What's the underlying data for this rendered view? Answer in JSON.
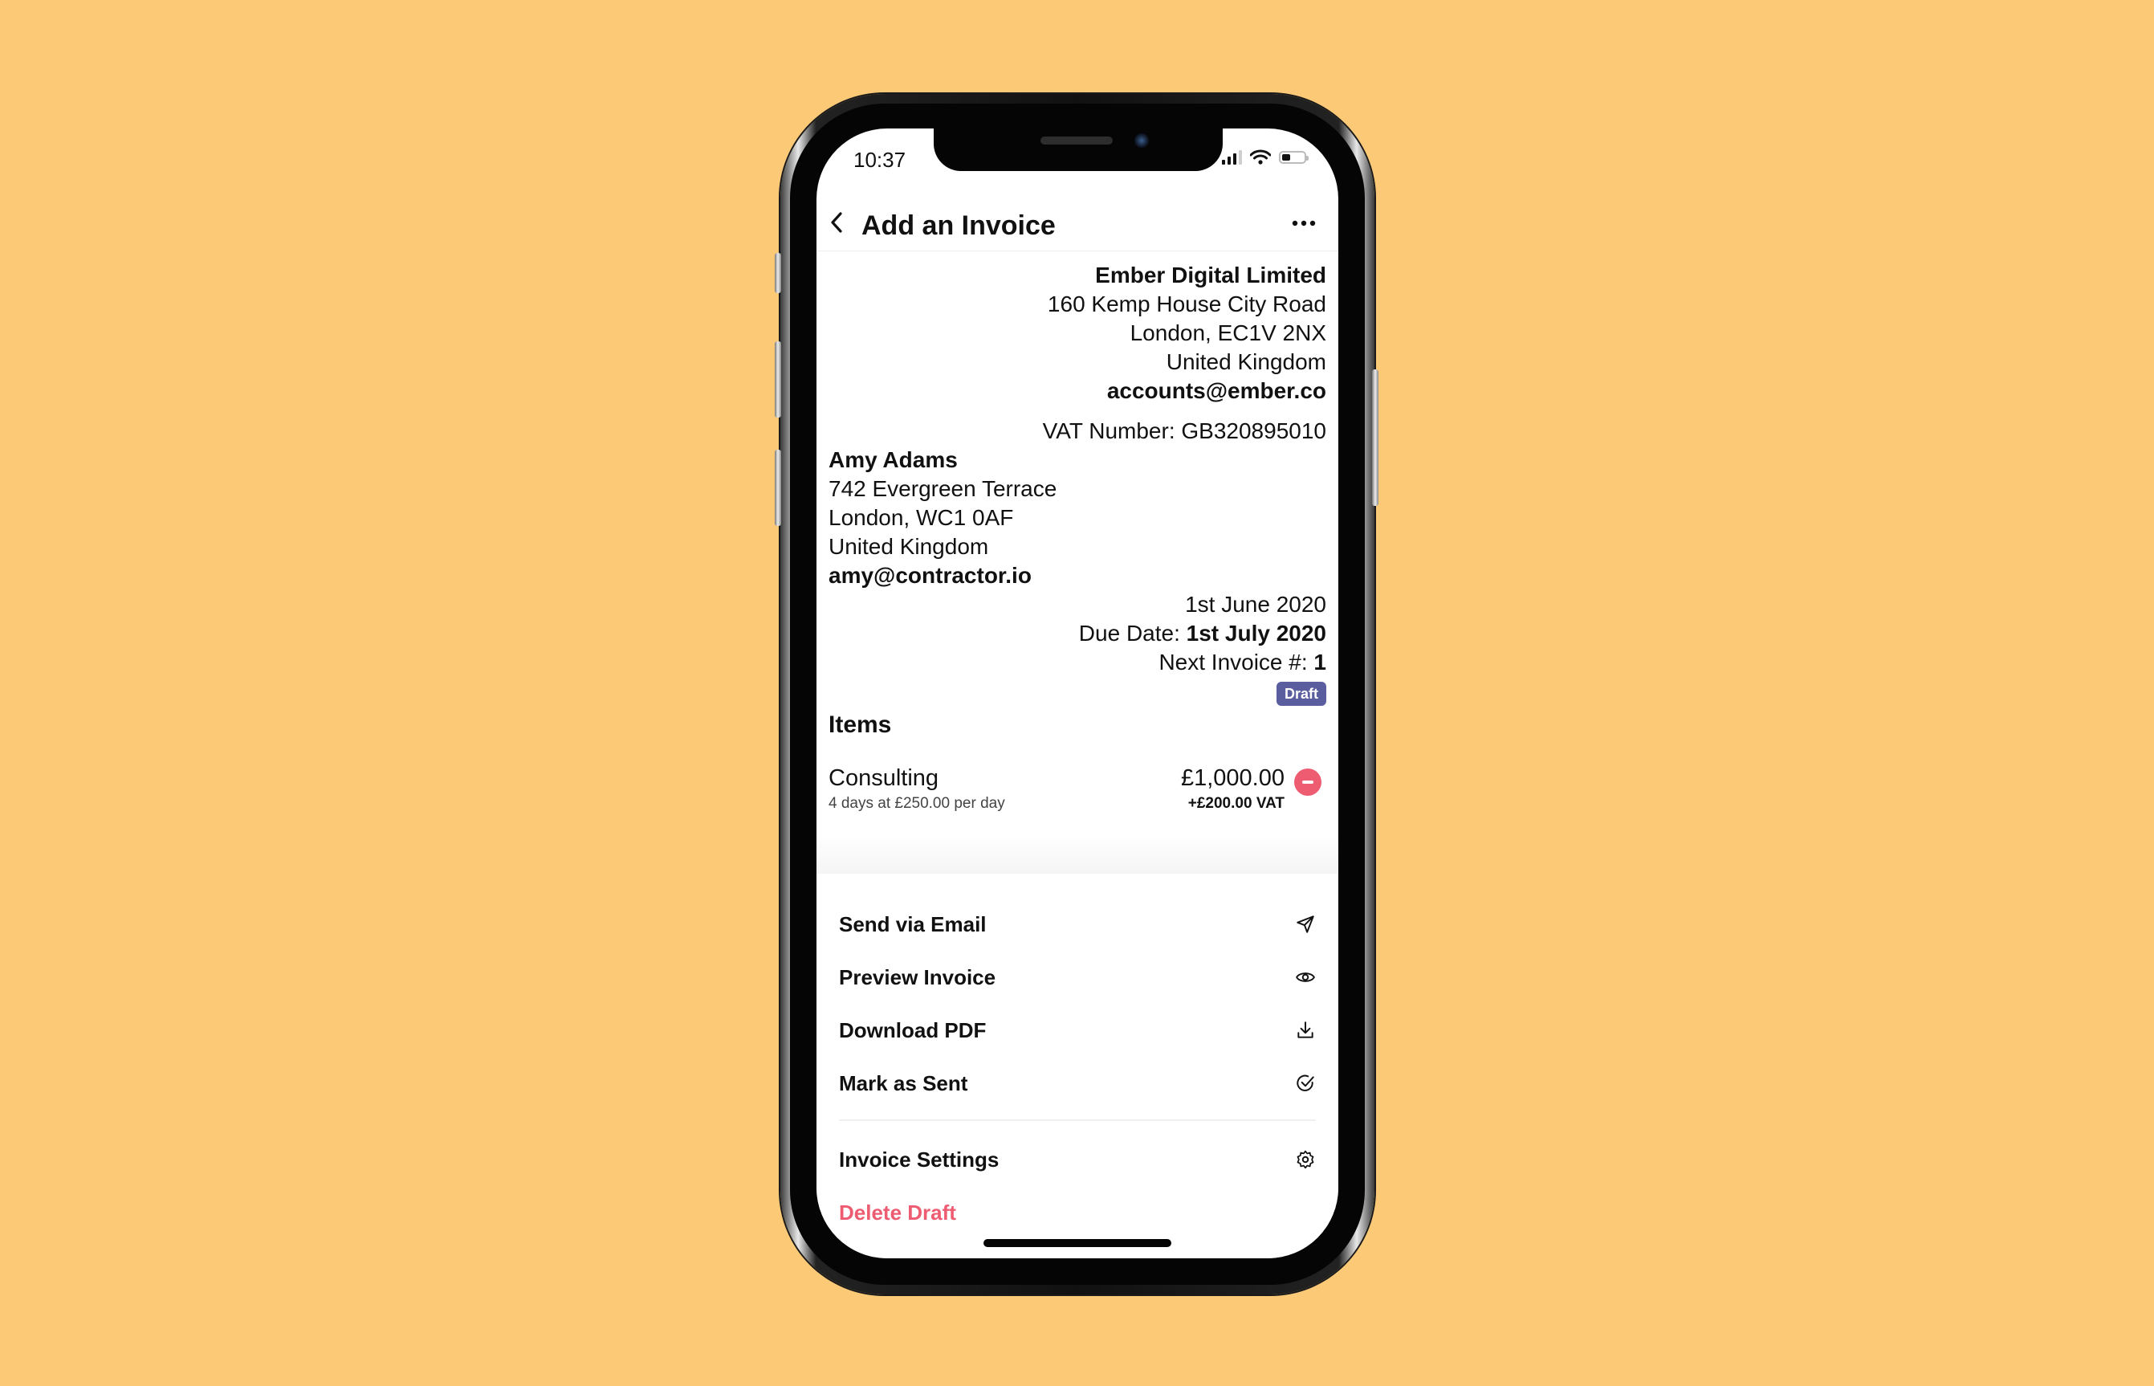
{
  "status_bar": {
    "time": "10:37",
    "signal_bars": 3,
    "signal_max": 4,
    "battery_level": 0.4
  },
  "header": {
    "back_icon": "chevron-left-icon",
    "title": "Add an Invoice",
    "more_icon": "ellipsis-icon"
  },
  "sender": {
    "name": "Ember Digital Limited",
    "address_line1": "160 Kemp House City Road",
    "address_line2": "London, EC1V 2NX",
    "country": "United Kingdom",
    "email": "accounts@ember.co",
    "vat": "VAT Number: GB320895010"
  },
  "recipient": {
    "name": "Amy Adams",
    "address_line1": "742 Evergreen Terrace",
    "address_line2": "London, WC1 0AF",
    "country": "United Kingdom",
    "email": "amy@contractor.io"
  },
  "meta": {
    "issue_date": "1st June 2020",
    "due_label": "Due Date: ",
    "due_date": "1st July 2020",
    "next_label": "Next Invoice #: ",
    "next_number": "1",
    "status_badge": "Draft"
  },
  "items": {
    "title": "Items",
    "list": [
      {
        "name": "Consulting",
        "description": "4 days at £250.00 per day",
        "amount": "£1,000.00",
        "vat": "+£200.00 VAT"
      }
    ]
  },
  "actions": [
    {
      "label": "Send via Email",
      "icon": "send-icon"
    },
    {
      "label": "Preview Invoice",
      "icon": "eye-icon"
    },
    {
      "label": "Download PDF",
      "icon": "download-icon"
    },
    {
      "label": "Mark as Sent",
      "icon": "check-circle-icon"
    },
    {
      "label": "Invoice Settings",
      "icon": "gear-icon"
    },
    {
      "label": "Delete Draft",
      "icon": ""
    }
  ],
  "colors": {
    "background": "#FCC977",
    "badge": "#5A5E9E",
    "danger": "#EE5C72"
  }
}
